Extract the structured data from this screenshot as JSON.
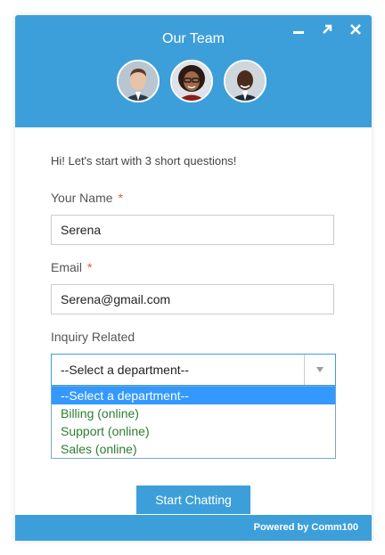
{
  "header": {
    "title": "Our Team",
    "controls": [
      "minimize-icon",
      "popout-icon",
      "close-icon"
    ],
    "avatars": [
      "agent-avatar-1",
      "agent-avatar-2",
      "agent-avatar-3"
    ]
  },
  "form": {
    "intro": "Hi! Let's start with 3 short questions!",
    "name_label": "Your Name",
    "name_value": "Serena",
    "email_label": "Email",
    "email_value": "Serena@gmail.com",
    "required_mark": "*",
    "inquiry_label": "Inquiry Related",
    "department_selected": "--Select a department--",
    "department_options": [
      "--Select a department--",
      "Billing (online)",
      "Support (online)",
      "Sales (online)"
    ],
    "start_button": "Start Chatting"
  },
  "footer": {
    "text": "Powered by Comm100"
  },
  "colors": {
    "accent": "#3d9fd9",
    "required": "#e5573a",
    "online_option": "#2e7d32",
    "highlight": "#3399ff"
  }
}
